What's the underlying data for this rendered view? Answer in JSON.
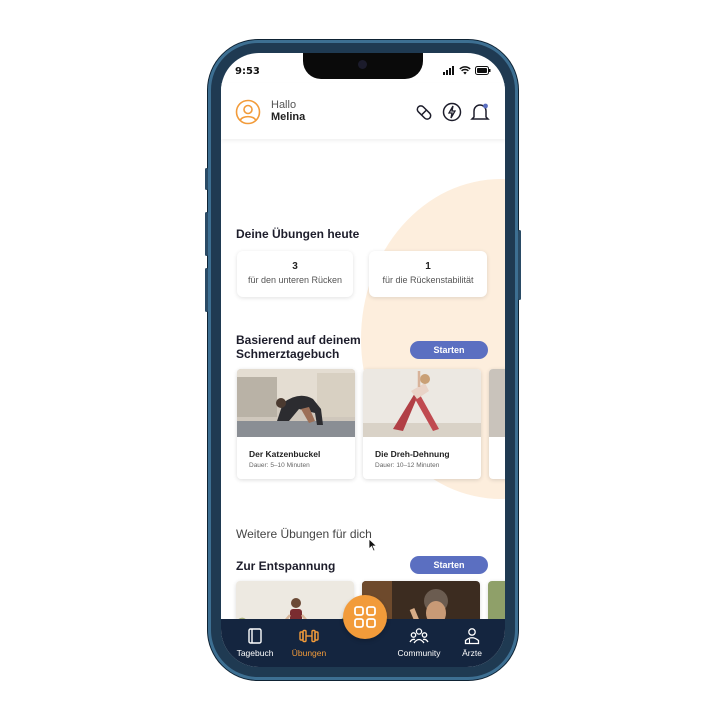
{
  "status": {
    "time": "9:53"
  },
  "header": {
    "greeting": "Hallo",
    "name": "Melina"
  },
  "today": {
    "title": "Deine Übungen heute",
    "cards": [
      {
        "count": "3",
        "label": "für den unteren Rücken"
      },
      {
        "count": "1",
        "label": "für die Rückenstabilität"
      }
    ]
  },
  "diary_based": {
    "title_line1": "Basierend auf deinem",
    "title_line2": "Schmerztagebuch",
    "start_label": "Starten",
    "exercises": [
      {
        "name": "Der Katzenbuckel",
        "duration": "Dauer: 5–10 Minuten"
      },
      {
        "name": "Die Dreh-Dehnung",
        "duration": "Dauer: 10–12 Minuten"
      }
    ]
  },
  "more": {
    "title": "Weitere Übungen für dich"
  },
  "relax": {
    "title": "Zur Entspannung",
    "start_label": "Starten"
  },
  "tabs": [
    {
      "label": "Tagebuch",
      "icon": "journal-icon"
    },
    {
      "label": "Übungen",
      "icon": "dumbbell-icon"
    },
    {
      "label": "Community",
      "icon": "community-icon"
    },
    {
      "label": "Ärzte",
      "icon": "doctor-icon"
    }
  ],
  "colors": {
    "accent": "#f29b3a",
    "pill": "#5b6fc1",
    "tabbar": "#14253f",
    "blob": "#fdeedd",
    "phone": "#1f3a52"
  }
}
